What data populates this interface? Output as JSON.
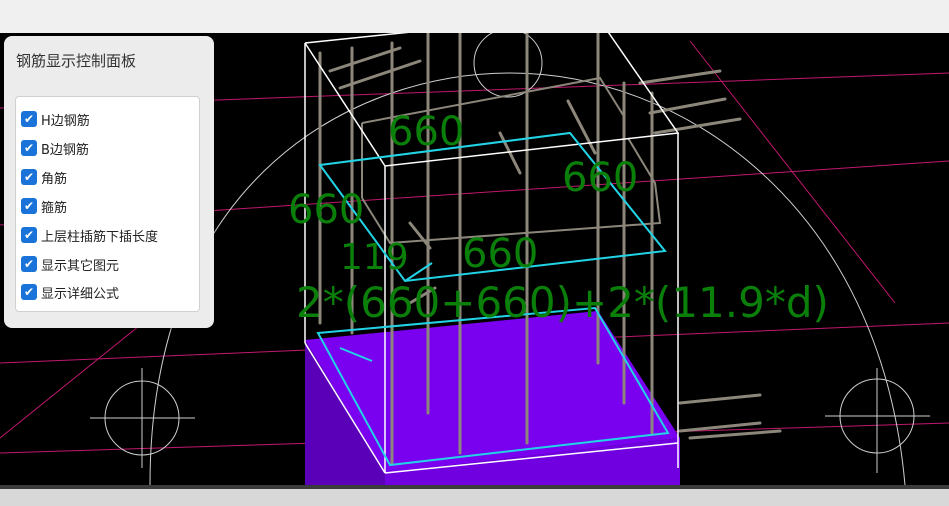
{
  "panel": {
    "title": "钢筋显示控制面板",
    "options": [
      {
        "label": "H边钢筋",
        "checked": true
      },
      {
        "label": "B边钢筋",
        "checked": true
      },
      {
        "label": "角筋",
        "checked": true
      },
      {
        "label": "箍筋",
        "checked": true
      },
      {
        "label": "上层柱插筋下插长度",
        "checked": true
      },
      {
        "label": "显示其它图元",
        "checked": true
      },
      {
        "label": "显示详细公式",
        "checked": true
      }
    ]
  },
  "annotations": {
    "dim_top_left": "660",
    "dim_top_right": "660",
    "dim_left": "660",
    "dim_center": "660",
    "dim_hook": "119",
    "formula": "2*(660+660)+2*(11.9*d)"
  },
  "colors": {
    "viewport_bg": "#000000",
    "column_fill": "#7a00f0",
    "stirrup": "#22d3e6",
    "rebar": "#8c877a",
    "outline": "#ffffff",
    "dimension_text": "#0a7f0a",
    "guide_line": "#c0186e",
    "checkbox": "#1a73d9"
  }
}
